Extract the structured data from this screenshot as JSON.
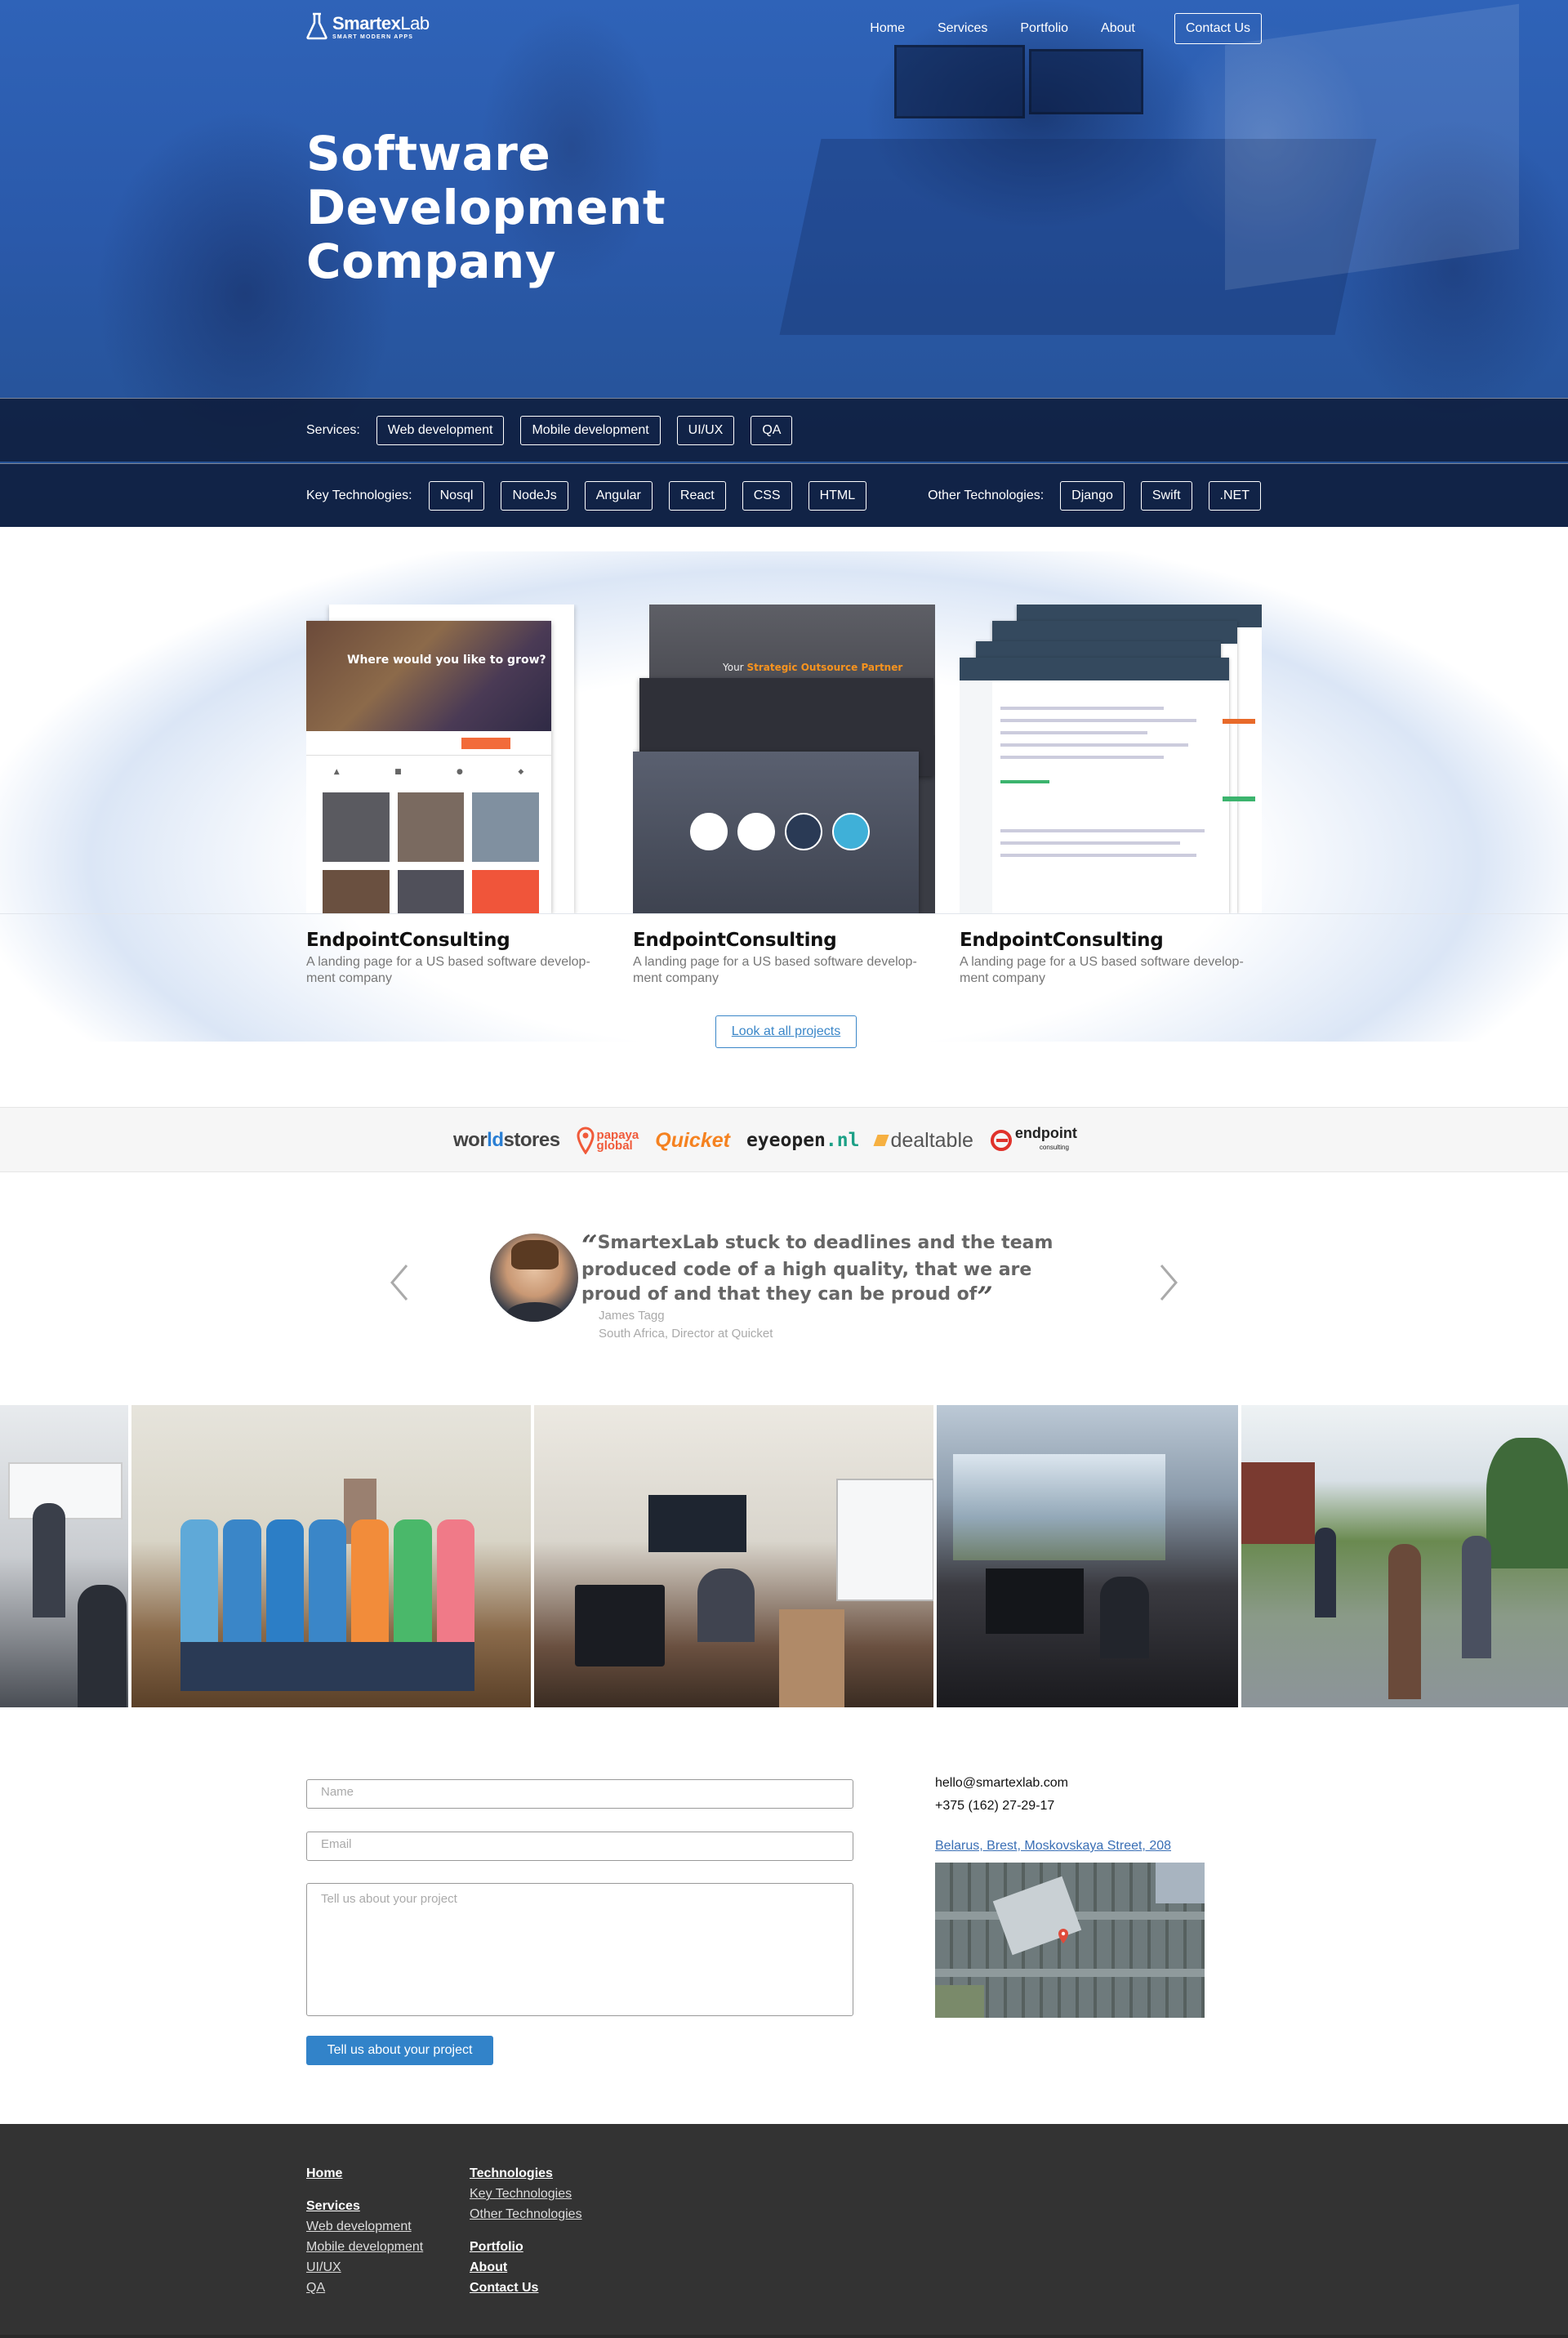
{
  "brand": {
    "name_bold": "Smartex",
    "name_light": "Lab",
    "tagline": "SMART MODERN APPS"
  },
  "nav": {
    "items": [
      "Home",
      "Services",
      "Portfolio",
      "About"
    ],
    "contact": "Contact Us"
  },
  "hero": {
    "title_line1": "Software",
    "title_line2": "Development",
    "title_line3": "Company"
  },
  "services_bar": {
    "label": "Services:",
    "tags": [
      "Web development",
      "Mobile development",
      "UI/UX",
      "QA"
    ]
  },
  "tech_bar": {
    "key_label": "Key Technologies:",
    "key_tags": [
      "Nosql",
      "NodeJs",
      "Angular",
      "React",
      "CSS",
      "HTML"
    ],
    "other_label": "Other Technologies:",
    "other_tags": [
      "Django",
      "Swift",
      ".NET"
    ]
  },
  "projects": [
    {
      "title": "EndpointConsulting",
      "desc": "A landing page for a US based software develop-ment company"
    },
    {
      "title": "EndpointConsulting",
      "desc": "A landing page for a US based software develop-ment company"
    },
    {
      "title": "EndpointConsulting",
      "desc": "A landing page for a US based software develop-ment company"
    }
  ],
  "project_mock": {
    "p1_heading": "Where would you like to grow?",
    "p2_heading_a": "Your ",
    "p2_heading_b": "Strategic Outsource Partner"
  },
  "all_projects_button": "Look at all projects",
  "clients": {
    "worldstores_a": "wor",
    "worldstores_b": "ld",
    "worldstores_c": "stores",
    "papaya_a": "papaya",
    "papaya_b": "global",
    "quicket": "Quicket",
    "eyeopen_a": "eyeopen",
    "eyeopen_b": ".nl",
    "dealtable": "dealtable",
    "endpoint": "endpoint",
    "endpoint_sub": "consulting"
  },
  "testimonial": {
    "quote": "SmartexLab  stuck to deadlines and the team produced code of a high quality, that we are proud of and that they can be proud of",
    "author": "James Tagg",
    "role": "South Africa, Director at Quicket"
  },
  "form": {
    "name_placeholder": "Name",
    "email_placeholder": "Email",
    "message_placeholder": "Tell us about your project",
    "submit": "Tell us about your project"
  },
  "contact_info": {
    "email": "hello@smartexlab.com",
    "phone": "+375 (162) 27-29-17",
    "address": "Belarus, Brest, Moskovskaya Street, 208"
  },
  "footer": {
    "home": "Home",
    "services": "Services",
    "service_links": [
      "Web development",
      "Mobile development",
      "UI/UX",
      "QA"
    ],
    "technologies": "Technologies",
    "tech_links": [
      "Key Technologies",
      "Other Technologies"
    ],
    "portfolio": "Portfolio",
    "about": "About",
    "contact": "Contact Us"
  },
  "colors": {
    "hero_blue": "#2a5db0",
    "accent": "#3283c9",
    "footer_bg": "#333333"
  },
  "icons": [
    "flask-logo-icon",
    "chevron-left-icon",
    "chevron-right-icon",
    "map-pin-icon"
  ]
}
